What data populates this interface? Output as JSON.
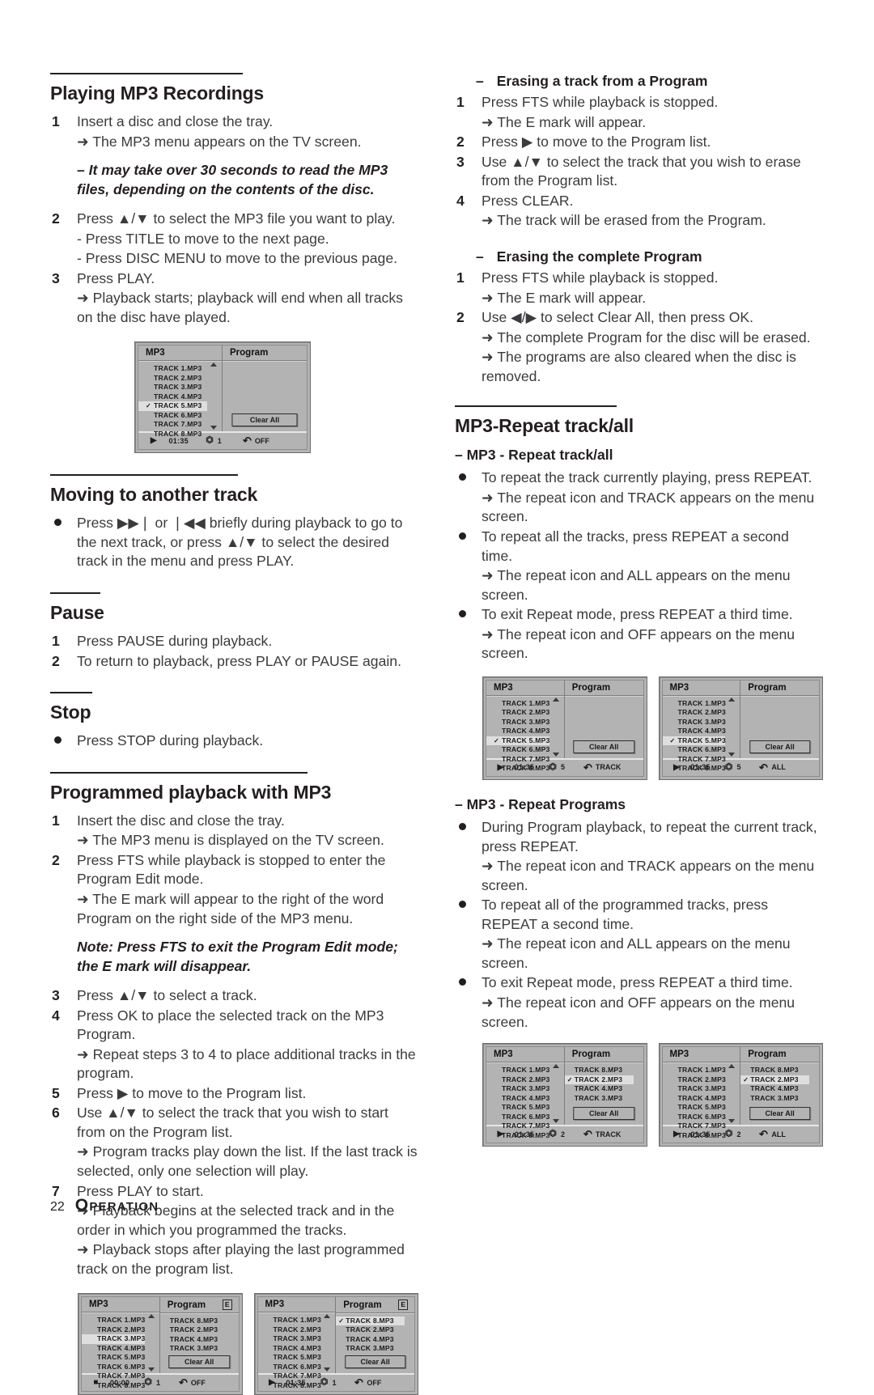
{
  "page": {
    "number": "22",
    "section_label_first": "O",
    "section_label_rest": "PERATION"
  },
  "left_column": {
    "sections": [
      {
        "heading": "Playing MP3 Recordings",
        "steps": [
          {
            "marker": "1",
            "text": "Insert a disc and close the tray."
          },
          {
            "marker": "",
            "text": "➜ The MP3 menu appears on the TV screen."
          },
          {
            "marker": "",
            "text": "–  It may take over 30 seconds to read the MP3 files, depending on the contents of the disc."
          },
          {
            "marker": "2",
            "text": "Press ▲/▼ to select the MP3 file you want to play."
          },
          {
            "marker": "",
            "text": "- Press TITLE to move to the next page."
          },
          {
            "marker": "",
            "text": "- Press DISC MENU to move to the previous page."
          },
          {
            "marker": "3",
            "text": "Press PLAY."
          },
          {
            "marker": "",
            "text": "➜ Playback starts; playback will end when all tracks on the disc have played."
          }
        ]
      },
      {
        "heading": "Moving to another track",
        "steps": [
          {
            "marker": "●",
            "text": "Press ▶▶❘ or ❘◀◀ briefly during playback to go to the next track, or press ▲/▼ to select the desired track in the menu and press PLAY."
          }
        ]
      },
      {
        "heading": "Pause",
        "steps": [
          {
            "marker": "1",
            "text": "Press PAUSE during playback."
          },
          {
            "marker": "2",
            "text": "To return to playback, press PLAY or PAUSE again."
          }
        ]
      },
      {
        "heading": "Stop",
        "steps": [
          {
            "marker": "●",
            "text": "Press STOP during playback."
          }
        ]
      },
      {
        "heading": "Programmed playback with MP3",
        "steps": [
          {
            "marker": "1",
            "text": "Insert the disc and close the tray."
          },
          {
            "marker": "",
            "text": "➜ The MP3 menu is displayed on the TV screen."
          },
          {
            "marker": "2",
            "text": "Press FTS while playback is stopped to enter the Program Edit mode."
          },
          {
            "marker": "",
            "text": "➜ The E mark will appear to the right of the word Program on the right side of the MP3 menu."
          },
          {
            "marker": "note",
            "text": "Note: Press FTS to exit the Program Edit mode;  the E mark will disappear."
          },
          {
            "marker": "3",
            "text": "Press ▲/▼ to select a track."
          },
          {
            "marker": "4",
            "text": "Press OK to place the selected track on the MP3 Program."
          },
          {
            "marker": "",
            "text": "➜ Repeat steps 3 to 4 to place additional tracks in the program."
          },
          {
            "marker": "5",
            "text": "Press ▶ to move to the Program list."
          },
          {
            "marker": "6",
            "text": "Use ▲/▼ to select the track that you wish to start from on the Program list."
          },
          {
            "marker": "",
            "text": "➜ Program tracks play down the list. If the last track is selected, only one selection will play."
          },
          {
            "marker": "7",
            "text": "Press PLAY to start."
          },
          {
            "marker": "",
            "text": "➜ Playback begins at the selected track and in the order in which you programmed the tracks."
          },
          {
            "marker": "",
            "text": "➜ Playback stops after playing the last programmed track on the program list."
          }
        ]
      }
    ]
  },
  "right_column": {
    "sections": [
      {
        "heading": "Erasing a track from a Program",
        "dash": "–",
        "steps": [
          {
            "marker": "1",
            "text": "Press FTS while playback is stopped."
          },
          {
            "marker": "",
            "text": "➜ The E mark will appear."
          },
          {
            "marker": "2",
            "text": "Press ▶ to move to the Program list."
          },
          {
            "marker": "3",
            "text": "Use ▲/▼ to select the track that you wish to erase from the Program list."
          },
          {
            "marker": "4",
            "text": "Press CLEAR."
          },
          {
            "marker": "",
            "text": "➜ The track will be erased from the Program."
          }
        ]
      },
      {
        "heading": "Erasing the complete Program",
        "dash": "–",
        "steps": [
          {
            "marker": "1",
            "text": "Press FTS while playback is stopped."
          },
          {
            "marker": "",
            "text": "➜ The E mark will appear."
          },
          {
            "marker": "2",
            "text": "Use ◀/▶ to select Clear All, then press OK."
          },
          {
            "marker": "",
            "text": "➜ The complete Program for the disc will be erased."
          },
          {
            "marker": "",
            "text": "➜ The programs are also cleared when the disc is removed."
          }
        ]
      },
      {
        "heading": "MP3-Repeat track/all",
        "subheading": "– MP3 - Repeat track/all",
        "steps": [
          {
            "marker": "●",
            "text": "To repeat the track currently playing, press REPEAT."
          },
          {
            "marker": "",
            "text": "➜ The repeat icon and TRACK appears on the menu screen."
          },
          {
            "marker": "●",
            "text": "To repeat all the tracks, press REPEAT a second time."
          },
          {
            "marker": "",
            "text": "➜ The repeat icon and ALL appears on the menu screen."
          },
          {
            "marker": "●",
            "text": "To exit Repeat mode, press REPEAT a third time."
          },
          {
            "marker": "",
            "text": "➜ The repeat icon and OFF appears on the menu screen."
          }
        ]
      },
      {
        "subheading": "– MP3 - Repeat Programs",
        "steps": [
          {
            "marker": "●",
            "text": "During Program playback, to repeat the current track, press REPEAT."
          },
          {
            "marker": "",
            "text": "➜ The repeat icon and TRACK appears on the menu screen."
          },
          {
            "marker": "●",
            "text": "To repeat all of the programmed tracks, press REPEAT a second time."
          },
          {
            "marker": "",
            "text": "➜ The repeat icon and ALL appears on the menu screen."
          },
          {
            "marker": "●",
            "text": "To exit Repeat mode, press REPEAT a third time."
          },
          {
            "marker": "",
            "text": "➜ The repeat icon and OFF appears on the menu screen."
          }
        ]
      }
    ]
  },
  "figures": {
    "fig1": {
      "left_title": "MP3",
      "right_title": "Program",
      "emark": "",
      "left_tracks": [
        "TRACK 1.MP3",
        "TRACK 2.MP3",
        "TRACK 3.MP3",
        "TRACK 4.MP3",
        "TRACK 5.MP3",
        "TRACK 6.MP3",
        "TRACK 7.MP3",
        "TRACK 8.MP3"
      ],
      "left_selected": "TRACK 5.MP3",
      "left_checked": "TRACK 5.MP3",
      "right_tracks": [],
      "right_selected": "",
      "right_checked": "",
      "clear_all": "Clear All",
      "status_play": "▶",
      "status_time": "01:35",
      "status_track": "1",
      "status_repeat": "OFF"
    },
    "fig2": {
      "left_title": "MP3",
      "right_title": "Program",
      "emark": "E",
      "left_tracks": [
        "TRACK 1.MP3",
        "TRACK 2.MP3",
        "TRACK 3.MP3",
        "TRACK 4.MP3",
        "TRACK 5.MP3",
        "TRACK 6.MP3",
        "TRACK 7.MP3",
        "TRACK 8.MP3"
      ],
      "left_selected": "TRACK 3.MP3",
      "left_checked": "",
      "right_tracks": [
        "TRACK 8.MP3",
        "TRACK 2.MP3",
        "TRACK 4.MP3",
        "TRACK 3.MP3"
      ],
      "right_selected": "",
      "right_checked": "",
      "clear_all": "Clear All",
      "status_play": "■",
      "status_time": "00:00",
      "status_track": "1",
      "status_repeat": "OFF"
    },
    "fig3": {
      "left_title": "MP3",
      "right_title": "Program",
      "emark": "E",
      "left_tracks": [
        "TRACK 1.MP3",
        "TRACK 2.MP3",
        "TRACK 3.MP3",
        "TRACK 4.MP3",
        "TRACK 5.MP3",
        "TRACK 6.MP3",
        "TRACK 7.MP3",
        "TRACK 8.MP3"
      ],
      "left_selected": "",
      "left_checked": "",
      "right_tracks": [
        "TRACK 8.MP3",
        "TRACK 2.MP3",
        "TRACK 4.MP3",
        "TRACK 3.MP3"
      ],
      "right_selected": "TRACK 8.MP3",
      "right_checked": "TRACK 8.MP3",
      "clear_all": "Clear All",
      "status_play": "▶",
      "status_time": "01:35",
      "status_track": "1",
      "status_repeat": "OFF"
    },
    "fig4": {
      "left_title": "MP3",
      "right_title": "Program",
      "emark": "",
      "left_tracks": [
        "TRACK 1.MP3",
        "TRACK 2.MP3",
        "TRACK 3.MP3",
        "TRACK 4.MP3",
        "TRACK 5.MP3",
        "TRACK 6.MP3",
        "TRACK 7.MP3",
        "TRACK 8.MP3"
      ],
      "left_selected": "TRACK 5.MP3",
      "left_checked": "TRACK 5.MP3",
      "right_tracks": [],
      "right_selected": "",
      "right_checked": "",
      "clear_all": "Clear All",
      "status_play": "▶",
      "status_time": "01:35",
      "status_track": "5",
      "status_repeat": "TRACK"
    },
    "fig5": {
      "left_title": "MP3",
      "right_title": "Program",
      "emark": "",
      "left_tracks": [
        "TRACK 1.MP3",
        "TRACK 2.MP3",
        "TRACK 3.MP3",
        "TRACK 4.MP3",
        "TRACK 5.MP3",
        "TRACK 6.MP3",
        "TRACK 7.MP3",
        "TRACK 8.MP3"
      ],
      "left_selected": "TRACK 5.MP3",
      "left_checked": "TRACK 5.MP3",
      "right_tracks": [],
      "right_selected": "",
      "right_checked": "",
      "clear_all": "Clear All",
      "status_play": "▶",
      "status_time": "01:35",
      "status_track": "5",
      "status_repeat": "ALL"
    },
    "fig6": {
      "left_title": "MP3",
      "right_title": "Program",
      "emark": "",
      "left_tracks": [
        "TRACK 1.MP3",
        "TRACK 2.MP3",
        "TRACK 3.MP3",
        "TRACK 4.MP3",
        "TRACK 5.MP3",
        "TRACK 6.MP3",
        "TRACK 7.MP3",
        "TRACK 8.MP3"
      ],
      "left_selected": "",
      "left_checked": "",
      "right_tracks": [
        "TRACK 8.MP3",
        "TRACK 2.MP3",
        "TRACK 4.MP3",
        "TRACK 3.MP3"
      ],
      "right_selected": "TRACK 2.MP3",
      "right_checked": "TRACK 2.MP3",
      "clear_all": "Clear All",
      "status_play": "▶",
      "status_time": "01:35",
      "status_track": "2",
      "status_repeat": "TRACK"
    },
    "fig7": {
      "left_title": "MP3",
      "right_title": "Program",
      "emark": "",
      "left_tracks": [
        "TRACK 1.MP3",
        "TRACK 2.MP3",
        "TRACK 3.MP3",
        "TRACK 4.MP3",
        "TRACK 5.MP3",
        "TRACK 6.MP3",
        "TRACK 7.MP3",
        "TRACK 8.MP3"
      ],
      "left_selected": "",
      "left_checked": "",
      "right_tracks": [
        "TRACK 8.MP3",
        "TRACK 2.MP3",
        "TRACK 4.MP3",
        "TRACK 3.MP3"
      ],
      "right_selected": "TRACK 2.MP3",
      "right_checked": "TRACK 2.MP3",
      "clear_all": "Clear All",
      "status_play": "▶",
      "status_time": "01:35",
      "status_track": "2",
      "status_repeat": "ALL"
    }
  }
}
